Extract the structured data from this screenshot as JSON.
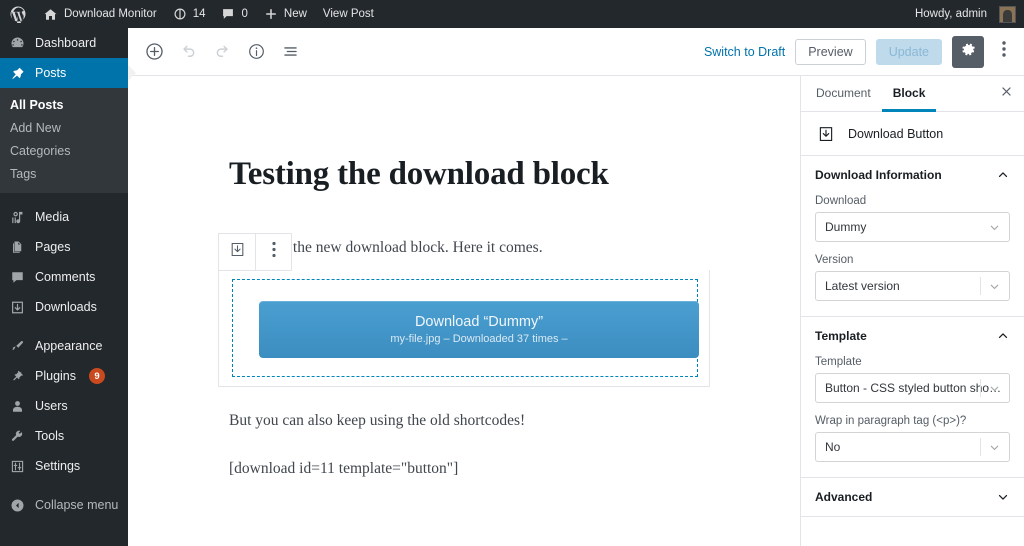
{
  "adminbar": {
    "logo_icon": "wordpress-logo-icon",
    "site_icon": "home-icon",
    "site_name": "Download Monitor",
    "updates_icon": "updates-icon",
    "updates_count": "14",
    "comments_icon": "comment-bubble-icon",
    "comments_count": "0",
    "new_icon": "plus-icon",
    "new_label": "New",
    "view_post_label": "View Post",
    "howdy": "Howdy, admin",
    "avatar_name": "avatar"
  },
  "sidebar": {
    "items": [
      {
        "label": "Dashboard",
        "icon": "dashboard-icon",
        "current": false
      },
      {
        "label": "Posts",
        "icon": "pin-icon",
        "current": true
      },
      {
        "label": "Media",
        "icon": "media-icon",
        "current": false
      },
      {
        "label": "Pages",
        "icon": "pages-icon",
        "current": false
      },
      {
        "label": "Comments",
        "icon": "comments-icon",
        "current": false
      },
      {
        "label": "Downloads",
        "icon": "download-box-icon",
        "current": false
      },
      {
        "label": "Appearance",
        "icon": "brush-icon",
        "current": false
      },
      {
        "label": "Plugins",
        "icon": "plug-icon",
        "current": false,
        "badge": "9"
      },
      {
        "label": "Users",
        "icon": "user-icon",
        "current": false
      },
      {
        "label": "Tools",
        "icon": "wrench-icon",
        "current": false
      },
      {
        "label": "Settings",
        "icon": "settings-sliders-icon",
        "current": false
      }
    ],
    "submenu": [
      {
        "label": "All Posts",
        "current": true
      },
      {
        "label": "Add New",
        "current": false
      },
      {
        "label": "Categories",
        "current": false
      },
      {
        "label": "Tags",
        "current": false
      }
    ],
    "collapse_label": "Collapse menu",
    "collapse_icon": "collapse-arrow-icon",
    "accent_color": "#0073aa",
    "badge_color": "#ca4a1f"
  },
  "editor_header": {
    "add_block_icon": "plus-circle-icon",
    "undo_icon": "undo-icon",
    "redo_icon": "redo-icon",
    "info_icon": "info-circle-icon",
    "block_nav_icon": "block-navigation-icon",
    "switch_to_draft_label": "Switch to Draft",
    "preview_label": "Preview",
    "update_label": "Update",
    "settings_icon": "gear-icon",
    "more_icon": "vertical-dots-icon",
    "link_color": "#0073aa"
  },
  "canvas": {
    "post_title": "Testing the download block",
    "paragraph_1": "st, I'll test the new download block. Here it comes.",
    "paragraph_2": "But you can also keep using the old shortcodes!",
    "paragraph_3": "[download id=11 template=\"button\"]",
    "block_toolbar": {
      "download_icon": "download-block-icon",
      "more_icon": "vertical-dots-icon"
    },
    "download_button": {
      "main_label": "Download “Dummy”",
      "sub_label": "my-file.jpg – Downloaded 37 times –",
      "gradient_top": "#4a9fd1",
      "gradient_bottom": "#3c8dc0",
      "selection_border_color": "#0085ba"
    }
  },
  "inspector": {
    "tabs": [
      {
        "label": "Document",
        "active": false
      },
      {
        "label": "Block",
        "active": true
      }
    ],
    "close_icon": "close-icon",
    "block_card": {
      "icon": "download-block-icon",
      "label": "Download Button"
    },
    "panels": [
      {
        "title": "Download Information",
        "expanded": true,
        "chevron_icon": "chevron-up-icon",
        "fields": [
          {
            "label": "Download",
            "value": "Dummy",
            "chevron_icon": "chevron-down-icon",
            "divided": false
          },
          {
            "label": "Version",
            "value": "Latest version",
            "chevron_icon": "chevron-down-icon",
            "divided": true
          }
        ]
      },
      {
        "title": "Template",
        "expanded": true,
        "chevron_icon": "chevron-up-icon",
        "fields": [
          {
            "label": "Template",
            "value": "Button - CSS styled button sho…",
            "chevron_icon": "chevron-down-icon",
            "divided": true
          },
          {
            "label": "Wrap in paragraph tag (<p>)?",
            "value": "No",
            "chevron_icon": "chevron-down-icon",
            "divided": true
          }
        ]
      },
      {
        "title": "Advanced",
        "expanded": false,
        "chevron_icon": "chevron-down-icon",
        "fields": []
      }
    ]
  }
}
